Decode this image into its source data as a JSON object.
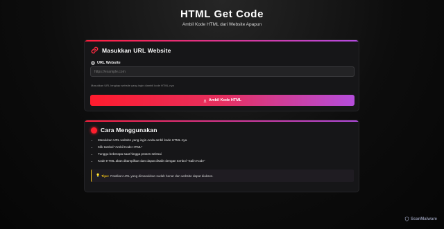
{
  "header": {
    "title": "HTML Get Code",
    "subtitle": "Ambil Kode HTML dari Website Apapun"
  },
  "url_card": {
    "title": "Masukkan URL Website",
    "field_label": "URL Website",
    "placeholder": "https://example.com",
    "value": "",
    "hint": "Masukkan URL lengkap website yang ingin diambil kode HTML-nya",
    "button_label": "Ambil Kode HTML"
  },
  "guide_card": {
    "title": "Cara Menggunakan",
    "steps": [
      "Masukkan URL website yang ingin Anda ambil kode HTML-nya",
      "Klik tombol \"Ambil Kode HTML\"",
      "Tunggu beberapa saat hingga proses selesai",
      "Kode HTML akan ditampilkan dan dapat disalin dengan tombol \"Salin Kode\""
    ],
    "tip_label": "Tips:",
    "tip_text": "Pastikan URL yang dimasukkan sudah benar dan website dapat diakses."
  },
  "watermark": "ScanMalware",
  "colors": {
    "accent_red": "#ff1e3c",
    "accent_purple": "#b44be1",
    "tip_yellow": "#f5c518"
  },
  "icons": {
    "url_card": "link-icon",
    "guide_card": "red-dot-icon",
    "field": "globe-icon",
    "button": "download-icon",
    "tip": "lightbulb-icon"
  }
}
